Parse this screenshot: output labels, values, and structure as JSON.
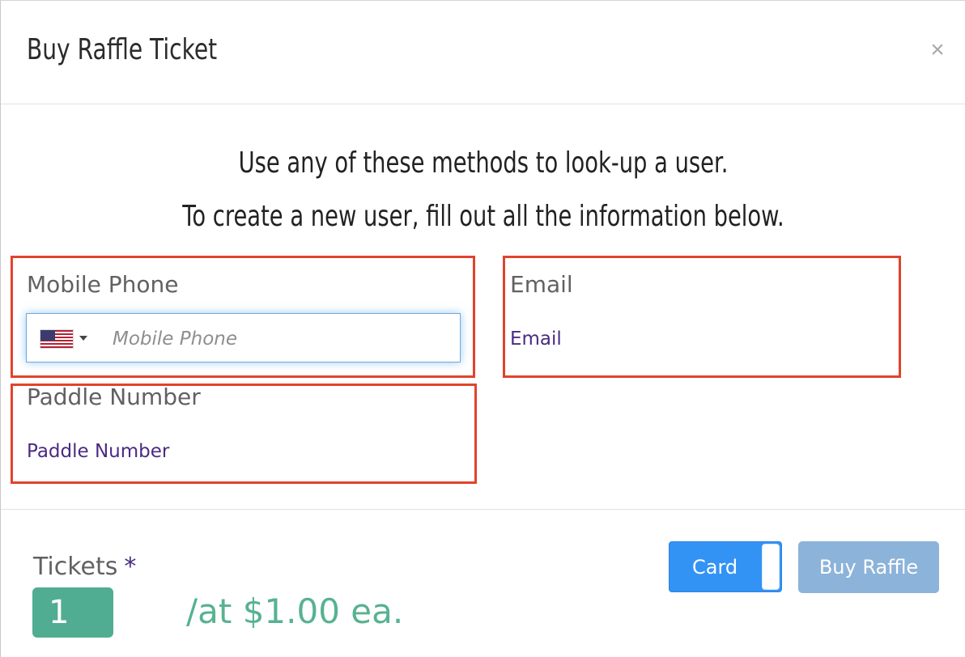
{
  "modal": {
    "title": "Buy Raffle Ticket",
    "close_label": "×"
  },
  "instructions": {
    "line1": "Use any of these methods to look-up a user.",
    "line2": "To create a new user, fill out all the information below."
  },
  "lookup": {
    "phone": {
      "label": "Mobile Phone",
      "placeholder": "Mobile Phone",
      "country_flag_icon": "us-flag-icon",
      "value": ""
    },
    "email": {
      "label": "Email",
      "placeholder": "Email",
      "value": ""
    },
    "paddle": {
      "label": "Paddle Number",
      "placeholder": "Paddle Number",
      "value": ""
    },
    "highlight_color": "#e1432c"
  },
  "purchase": {
    "tickets_label": "Tickets",
    "required_marker": "*",
    "quantity": "1",
    "price_text": "/at $1.00 ea.",
    "payment_method": "Card",
    "buy_button_label": "Buy Raffle"
  },
  "colors": {
    "accent_green": "#51ad91",
    "primary_blue": "#3393f5",
    "disabled_blue": "#8cb3d9",
    "link_purple": "#4a2b82"
  }
}
